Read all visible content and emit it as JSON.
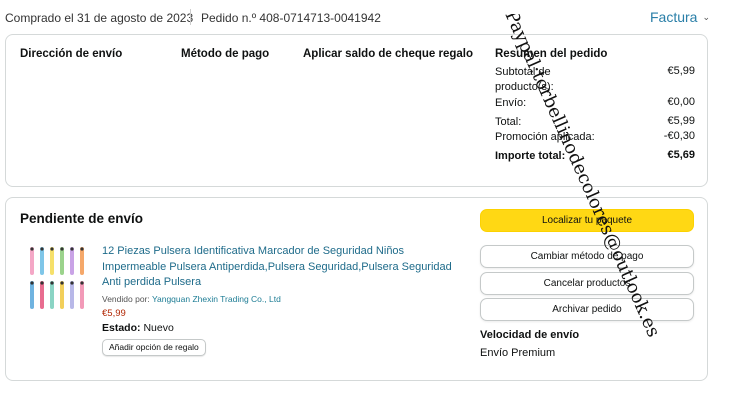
{
  "header": {
    "purchase_date": "Comprado el 31 de agosto de 2023",
    "order_number": "Pedido n.º 408-0714713-0041942",
    "invoice_label": "Factura",
    "invoice_chevron": "⌄"
  },
  "order_info": {
    "shipping_address_title": "Dirección de envío",
    "payment_method_title": "Método de pago",
    "gift_balance_title": "Aplicar saldo de cheque regalo",
    "summary_title": "Resumen del pedido",
    "summary_rows": [
      {
        "label": "Subtotal de producto(s):",
        "value": "€5,99"
      },
      {
        "label": "Envío:",
        "value": "€0,00"
      },
      {
        "label": "Total:",
        "value": "€5,99"
      },
      {
        "label": "Promoción aplicada:",
        "value": "-€0,30"
      },
      {
        "label": "Importe total:",
        "value": "€5,69"
      }
    ]
  },
  "shipment": {
    "status_title": "Pendiente de envío",
    "product": {
      "title": "12 Piezas Pulsera Identificativa Marcador de Seguridad Niños Impermeable Pulsera Antiperdida,Pulsera Seguridad,Pulsera Seguridad Anti perdida Pulsera",
      "seller_label": "Vendido por:",
      "seller_name": "Yangquan Zhexin Trading Co., Ltd",
      "price": "€5,99",
      "state_label": "Estado:",
      "state_value": "Nuevo",
      "gift_option": "Añadir opción de regalo"
    },
    "actions": {
      "track": "Localizar tu paquete",
      "change_payment": "Cambiar método de pago",
      "cancel": "Cancelar productos",
      "archive": "Archivar pedido"
    },
    "delivery_speed_label": "Velocidad de envío",
    "delivery_speed_value": "Envío Premium"
  },
  "watermark": {
    "text": "Paypal:torbellinodecolores@outlook.es"
  },
  "colors": {
    "link": "#1e6b8a",
    "price": "#b12704",
    "primary_button": "#ffd814",
    "invoice": "#2a7fa8"
  }
}
